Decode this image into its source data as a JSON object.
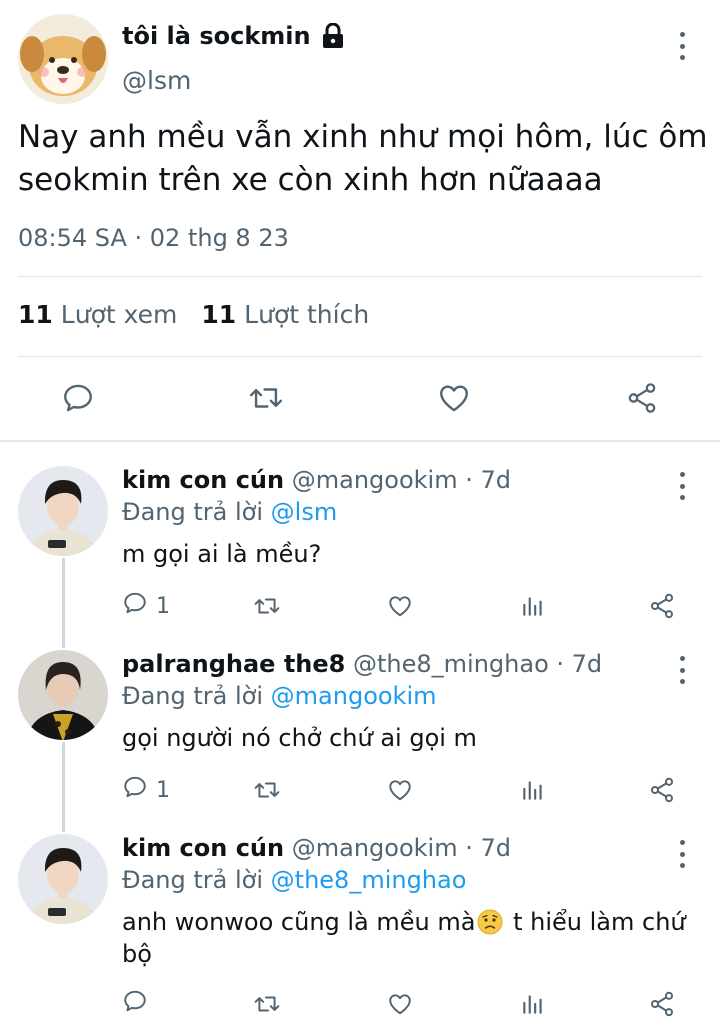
{
  "main_tweet": {
    "display_name": "tôi là sockmin",
    "handle": "@lsm",
    "text": "Nay anh mều vẫn xinh như mọi hôm, lúc ôm\nseokmin trên xe còn xinh hơn nữaaaa",
    "timestamp": "08:54 SA · 02 thg 8 23",
    "views_count": "11",
    "views_label": "Lượt xem",
    "likes_count": "11",
    "likes_label": "Lượt thích"
  },
  "replies": [
    {
      "display_name": "kim con cún",
      "handle_time": "@mangookim · 7d",
      "replying_label": "Đang trả lời",
      "replying_to": "@lsm",
      "text": "m gọi ai là mều?",
      "reply_count": "1"
    },
    {
      "display_name": "palranghae the8",
      "handle_time": "@the8_minghao · 7d",
      "replying_label": "Đang trả lời",
      "replying_to": "@mangookim",
      "text": "gọi người nó chở chứ ai gọi m",
      "reply_count": "1"
    },
    {
      "display_name": "kim con cún",
      "handle_time": "@mangookim · 7d",
      "replying_label": "Đang trả lời",
      "replying_to": "@the8_minghao",
      "text_before_emoji": "anh wonwoo cũng là mều mà",
      "text_after_emoji": " t hiểu làm chứ bộ",
      "reply_count": ""
    }
  ],
  "colors": {
    "accent": "#1d9bf0",
    "muted": "#536471",
    "divider": "#e1e6ea",
    "text": "#0f1419"
  },
  "icons": [
    "lock-icon",
    "more-icon",
    "reply-icon",
    "retweet-icon",
    "like-icon",
    "share-icon",
    "views-icon",
    "worried-face-emoji"
  ]
}
